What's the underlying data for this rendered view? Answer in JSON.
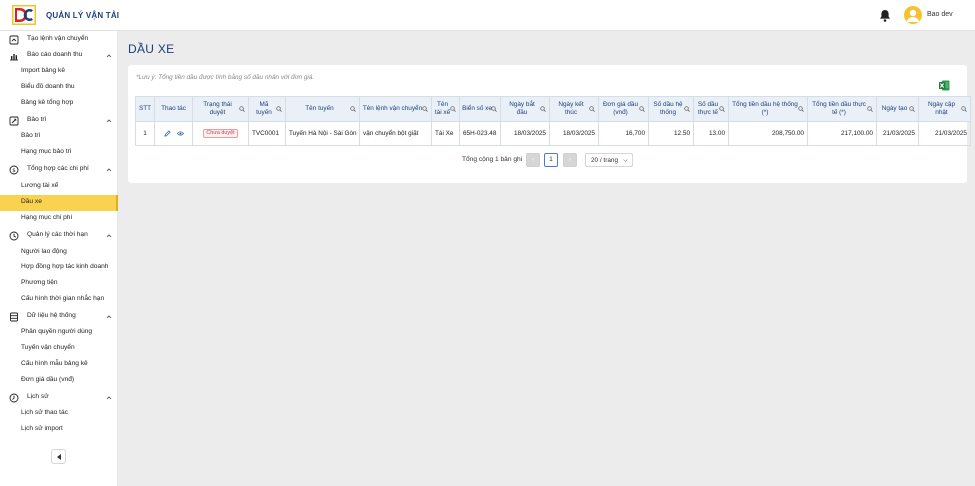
{
  "header": {
    "app_title": "QUẢN LÝ VẬN TẢI",
    "user_name": "Bao dev"
  },
  "sidebar": {
    "rows": [
      {
        "type": "group",
        "icon": "new-order-icon",
        "label": "Tạo lệnh vận chuyển",
        "chevron": false
      },
      {
        "type": "group",
        "icon": "bar-chart-icon",
        "label": "Báo cáo doanh thu",
        "chevron": true
      },
      {
        "type": "item",
        "label": "Import bảng kê"
      },
      {
        "type": "item",
        "label": "Biểu đồ doanh thu"
      },
      {
        "type": "item",
        "label": "Bảng kê tổng hợp"
      },
      {
        "type": "group",
        "icon": "wrench-icon",
        "label": "Bảo trì",
        "chevron": true
      },
      {
        "type": "item",
        "label": "Bảo trì"
      },
      {
        "type": "item",
        "label": "Hạng mục bảo trì"
      },
      {
        "type": "group",
        "icon": "dollar-icon",
        "label": "Tổng hợp các chi phí",
        "chevron": true
      },
      {
        "type": "item",
        "label": "Lương tài xế"
      },
      {
        "type": "item",
        "label": "Dầu xe",
        "active": true
      },
      {
        "type": "item",
        "label": "Hạng mục chi phí"
      },
      {
        "type": "group",
        "icon": "clock-icon",
        "label": "Quản lý các thời hạn",
        "chevron": true
      },
      {
        "type": "item",
        "label": "Người lao động"
      },
      {
        "type": "item",
        "label": "Hợp đồng hợp tác kinh doanh"
      },
      {
        "type": "item",
        "label": "Phương tiện"
      },
      {
        "type": "item",
        "label": "Cấu hình thời gian nhắc hạn"
      },
      {
        "type": "group",
        "icon": "database-icon",
        "label": "Dữ liệu hệ thống",
        "chevron": true
      },
      {
        "type": "item",
        "label": "Phân quyền người dùng"
      },
      {
        "type": "item",
        "label": "Tuyến vận chuyển"
      },
      {
        "type": "item",
        "label": "Cấu hình mẫu bảng kê"
      },
      {
        "type": "item",
        "label": "Đơn giá dầu (vnđ)"
      },
      {
        "type": "group",
        "icon": "history-icon",
        "label": "Lịch sử",
        "chevron": true
      },
      {
        "type": "item",
        "label": "Lịch sử thao tác"
      },
      {
        "type": "item",
        "label": "Lịch sử import"
      }
    ]
  },
  "main": {
    "page_title": "DẦU XE",
    "note": "*Lưu ý: Tổng tiền dầu được tính bằng số dầu nhân với đơn giá."
  },
  "table": {
    "columns": [
      {
        "label": "STT",
        "search": false
      },
      {
        "label": "Thao tác",
        "search": false
      },
      {
        "label": "Trạng thái duyệt",
        "search": true
      },
      {
        "label": "Mã tuyến",
        "search": true
      },
      {
        "label": "Tên tuyến",
        "search": true
      },
      {
        "label": "Tên lệnh vận chuyển",
        "search": true
      },
      {
        "label": "Tên tài xế",
        "search": true
      },
      {
        "label": "Biển số xe",
        "search": true
      },
      {
        "label": "Ngày bắt đầu",
        "search": true
      },
      {
        "label": "Ngày kết thúc",
        "search": true
      },
      {
        "label": "Đơn giá dầu (vnđ)",
        "search": true
      },
      {
        "label": "Số dầu hệ thống",
        "search": true
      },
      {
        "label": "Số dầu thực tế",
        "search": true
      },
      {
        "label": "Tổng tiền dầu hệ thống (*)",
        "search": true
      },
      {
        "label": "Tổng tiền dầu thực tế (*)",
        "search": true
      },
      {
        "label": "Ngày tạo",
        "search": true
      },
      {
        "label": "Ngày cập nhật",
        "search": true
      }
    ],
    "rows": [
      {
        "stt": "1",
        "status": "Chưa duyệt",
        "route_code": "TVC0001",
        "route_name": "Tuyến Hà Nội - Sài Gòn",
        "order_name": "vận chuyển bột giặt",
        "driver": "Tài Xe",
        "plate": "65H-023.48",
        "start_date": "18/03/2025",
        "end_date": "18/03/2025",
        "unit_price": "16,700",
        "system_fuel": "12.50",
        "actual_fuel": "13.00",
        "system_total": "208,750.00",
        "actual_total": "217,100.00",
        "created": "21/03/2025",
        "updated": "21/03/2025"
      }
    ]
  },
  "pagination": {
    "total_text": "Tổng cộng 1 bản ghi",
    "current_page": "1",
    "page_size": "20 / trang"
  }
}
